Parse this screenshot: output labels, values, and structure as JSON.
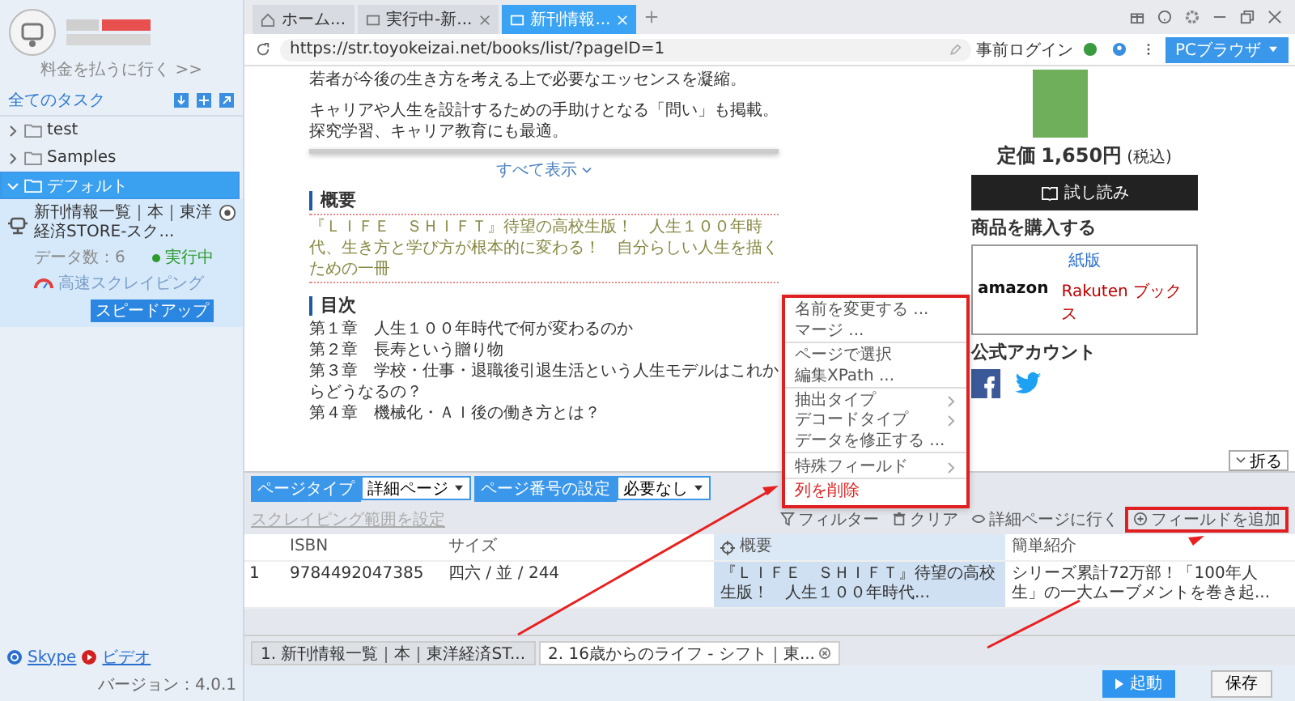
{
  "sidebar": {
    "account_link": "料金を払うに行く >>",
    "all_tasks": "全てのタスク",
    "tree": [
      {
        "label": "test",
        "expanded": false,
        "selected": false
      },
      {
        "label": "Samples",
        "expanded": false,
        "selected": false
      },
      {
        "label": "デフォルト",
        "expanded": true,
        "selected": true,
        "children": [
          {
            "title": "新刊情報一覧｜本｜東洋経済STORE-スク...",
            "data_count": "データ数：6",
            "status": "実行中",
            "mode": "高速スクレイピング",
            "speed_button": "スピードアップ"
          }
        ]
      }
    ],
    "links": [
      {
        "kind": "skype",
        "label": "Skype"
      },
      {
        "kind": "video",
        "label": "ビデオ"
      }
    ],
    "version": "バージョン：4.0.1"
  },
  "browser": {
    "tabs": [
      {
        "kind": "home",
        "label": "ホーム...",
        "selected": false
      },
      {
        "kind": "page",
        "label": "実行中-新...",
        "selected": false
      },
      {
        "kind": "page",
        "label": "新刊情報...",
        "selected": true
      }
    ],
    "url": "https://str.toyokeizai.net/books/list/?pageID=1",
    "prelogin": "事前ログイン",
    "mode": "PCブラウザ"
  },
  "page": {
    "intro": [
      "若者が今後の生き方を考える上で必要なエッセンスを凝縮。",
      "キャリアや人生を設計するための手助けとなる「問い」も掲載。",
      "探究学習、キャリア教育にも最適。"
    ],
    "show_all": "すべて表示",
    "summary_heading": "概要",
    "summary": "『ＬＩＦＥ　ＳＨＩＦＴ』待望の高校生版！　人生１００年時代、生き方と学び方が根本的に変わる！　自分らしい人生を描くための一冊",
    "toc_heading": "目次",
    "toc": [
      "第１章　人生１００年時代で何が変わるのか",
      "第２章　長寿という贈り物",
      "第３章　学校・仕事・退職後引退生活という人生モデルはこれからどうなるの？",
      "第４章　機械化・ＡＩ後の働き方とは？"
    ],
    "price_label": "定価",
    "price": "1,650円",
    "tax": "(税込)",
    "trial": "試し読み",
    "buy_heading": "商品を購入する",
    "paper": "紙版",
    "stores": [
      {
        "kind": "amazon",
        "label": "amazon"
      },
      {
        "kind": "rakuten",
        "label": "Rakuten ブックス"
      }
    ],
    "official_heading": "公式アカウント"
  },
  "context_menu": [
    {
      "label": "名前を変更する ...",
      "submenu": false,
      "danger": false,
      "divider_after": false
    },
    {
      "label": "マージ ...",
      "submenu": false,
      "danger": false,
      "divider_after": true
    },
    {
      "label": "ページで選択",
      "submenu": false,
      "danger": false,
      "divider_after": false
    },
    {
      "label": "編集XPath ...",
      "submenu": false,
      "danger": false,
      "divider_after": true
    },
    {
      "label": "抽出タイプ",
      "submenu": true,
      "danger": false,
      "divider_after": false
    },
    {
      "label": "デコードタイプ",
      "submenu": true,
      "danger": false,
      "divider_after": false
    },
    {
      "label": "データを修正する ...",
      "submenu": false,
      "danger": false,
      "divider_after": true
    },
    {
      "label": "特殊フィールド",
      "submenu": true,
      "danger": false,
      "divider_after": true
    },
    {
      "label": "列を削除",
      "submenu": false,
      "danger": true,
      "divider_after": false
    }
  ],
  "panel": {
    "collapse": "折る",
    "page_type_label": "ページタイプ",
    "page_type": "詳細ページ",
    "page_number_label": "ページ番号の設定",
    "page_number": "必要なし",
    "range_link": {
      "label": "スクレイピング範囲を設定",
      "disabled": true
    },
    "actions": [
      {
        "kind": "filter",
        "label": "フィルター",
        "highlighted": false
      },
      {
        "kind": "clear",
        "label": "クリア",
        "highlighted": false
      },
      {
        "kind": "detail",
        "label": "詳細ページに行く",
        "highlighted": false
      },
      {
        "kind": "add",
        "label": "フィールドを追加",
        "highlighted": true
      }
    ],
    "columns": [
      {
        "label": "ISBN",
        "selected": false
      },
      {
        "label": "サイズ",
        "selected": false
      },
      {
        "label": "概要",
        "selected": true
      },
      {
        "label": "簡単紹介",
        "selected": false
      }
    ],
    "rows": [
      {
        "index": "1",
        "cells": [
          "9784492047385",
          "四六 / 並 / 244",
          "『ＬＩＦＥ　ＳＨＩＦＴ』待望の高校生版！　人生１００年時代...",
          "シリーズ累計72万部！「100年人生」の一大ムーブメントを巻き起..."
        ]
      }
    ]
  },
  "bottom_tabs": [
    {
      "label": "1. 新刊情報一覧｜本｜東洋経済ST...",
      "selected": false
    },
    {
      "label": "2. 16歳からのライフ - シフト｜東...",
      "selected": true
    }
  ],
  "start": "起動",
  "save": "保存"
}
